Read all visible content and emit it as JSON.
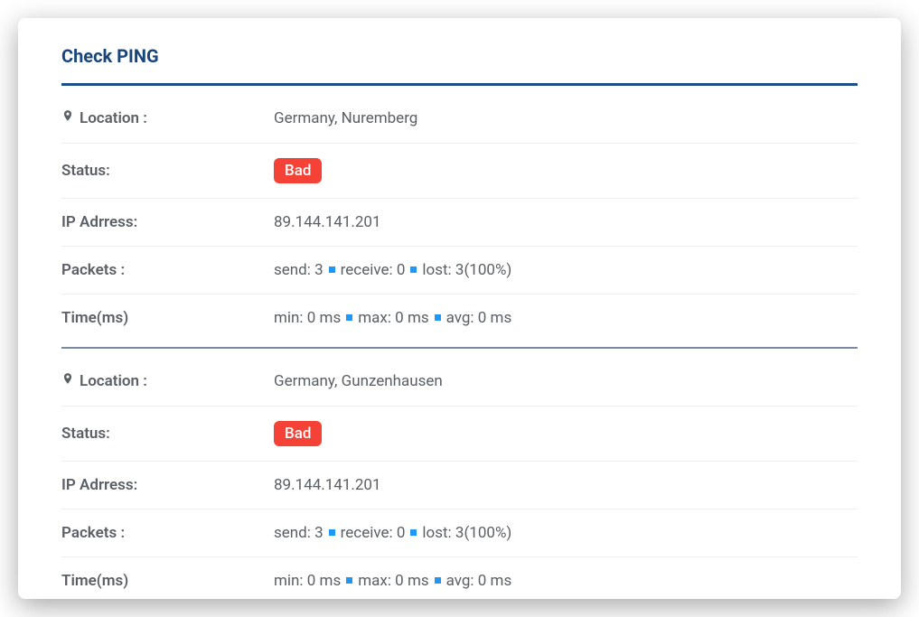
{
  "title": "Check PING",
  "labels": {
    "location": "Location :",
    "status": "Status:",
    "ip": "IP Adrress:",
    "packets": "Packets :",
    "time": "Time(ms)",
    "send": "send:",
    "receive": "receive:",
    "lost": "lost:",
    "min": "min:",
    "max": "max:",
    "avg": "avg:"
  },
  "results": [
    {
      "location": "Germany, Nuremberg",
      "status": "Bad",
      "ip": "89.144.141.201",
      "packets": {
        "send": "3",
        "receive": "0",
        "lost": "3(100%)"
      },
      "time": {
        "min": "0 ms",
        "max": "0 ms",
        "avg": "0 ms"
      }
    },
    {
      "location": "Germany, Gunzenhausen",
      "status": "Bad",
      "ip": "89.144.141.201",
      "packets": {
        "send": "3",
        "receive": "0",
        "lost": "3(100%)"
      },
      "time": {
        "min": "0 ms",
        "max": "0 ms",
        "avg": "0 ms"
      }
    }
  ]
}
